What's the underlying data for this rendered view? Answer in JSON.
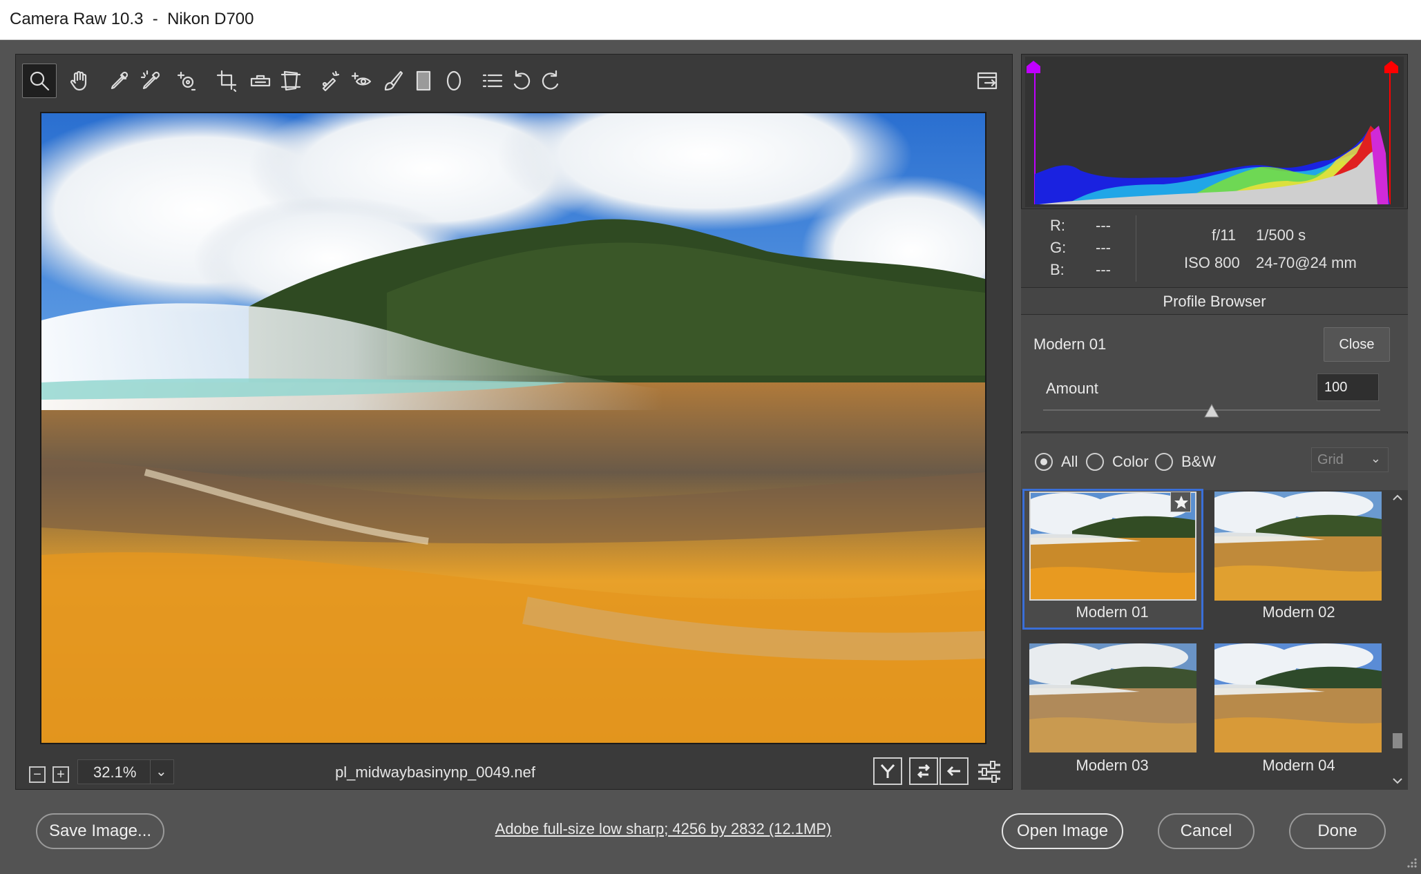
{
  "window": {
    "title": "Camera Raw 10.3  -  Nikon D700"
  },
  "toolbar": {
    "tools": [
      {
        "name": "zoom-tool",
        "icon": "magnifier-icon",
        "active": true
      },
      {
        "name": "hand-tool",
        "icon": "hand-icon"
      },
      {
        "name": "white-balance-tool",
        "icon": "eyedropper-icon"
      },
      {
        "name": "color-sampler-tool",
        "icon": "color-sampler-icon"
      },
      {
        "name": "targeted-adjustment-tool",
        "icon": "target-icon"
      },
      {
        "name": "crop-tool",
        "icon": "crop-icon"
      },
      {
        "name": "straighten-tool",
        "icon": "level-icon"
      },
      {
        "name": "transform-tool",
        "icon": "transform-icon"
      },
      {
        "name": "spot-removal-tool",
        "icon": "spot-removal-icon"
      },
      {
        "name": "red-eye-tool",
        "icon": "red-eye-icon"
      },
      {
        "name": "adjustment-brush-tool",
        "icon": "brush-icon"
      },
      {
        "name": "graduated-filter-tool",
        "icon": "gradient-icon"
      },
      {
        "name": "radial-filter-tool",
        "icon": "ellipse-icon"
      },
      {
        "name": "preferences-button",
        "icon": "list-icon"
      },
      {
        "name": "rotate-left-button",
        "icon": "rotate-ccw-icon"
      },
      {
        "name": "rotate-right-button",
        "icon": "rotate-cw-icon"
      }
    ],
    "fullscreen_icon": "fullscreen-toggle-icon"
  },
  "statusbar": {
    "zoom_value": "32.1%",
    "filename": "pl_midwaybasinynp_0049.nef",
    "zoom_out_label": "−",
    "zoom_in_label": "+"
  },
  "readout": {
    "r_label": "R:",
    "r_value": "---",
    "g_label": "G:",
    "g_value": "---",
    "b_label": "B:",
    "b_value": "---",
    "aperture": "f/11",
    "shutter": "1/500 s",
    "iso": "ISO 800",
    "lens": "24-70@24 mm"
  },
  "profile_browser": {
    "header": "Profile Browser",
    "current_profile": "Modern 01",
    "close_label": "Close",
    "amount_label": "Amount",
    "amount_value": "100",
    "amount_fraction": 0.5,
    "filters": {
      "all": "All",
      "color": "Color",
      "bw": "B&W",
      "selected": "all"
    },
    "view_select": "Grid",
    "profiles": [
      "Modern 01",
      "Modern 02",
      "Modern 03",
      "Modern 04"
    ],
    "selected_profile": "Modern 01"
  },
  "bottom": {
    "save_label": "Save Image...",
    "workflow_text": "Adobe full-size low sharp; 4256 by 2832 (12.1MP)",
    "open_label": "Open Image",
    "cancel_label": "Cancel",
    "done_label": "Done"
  },
  "colors": {
    "panel_bg": "#3c3c3c",
    "selection_blue": "#3a6fd8",
    "shadow_clip": "#c000ff",
    "highlight_clip": "#ff0000"
  }
}
